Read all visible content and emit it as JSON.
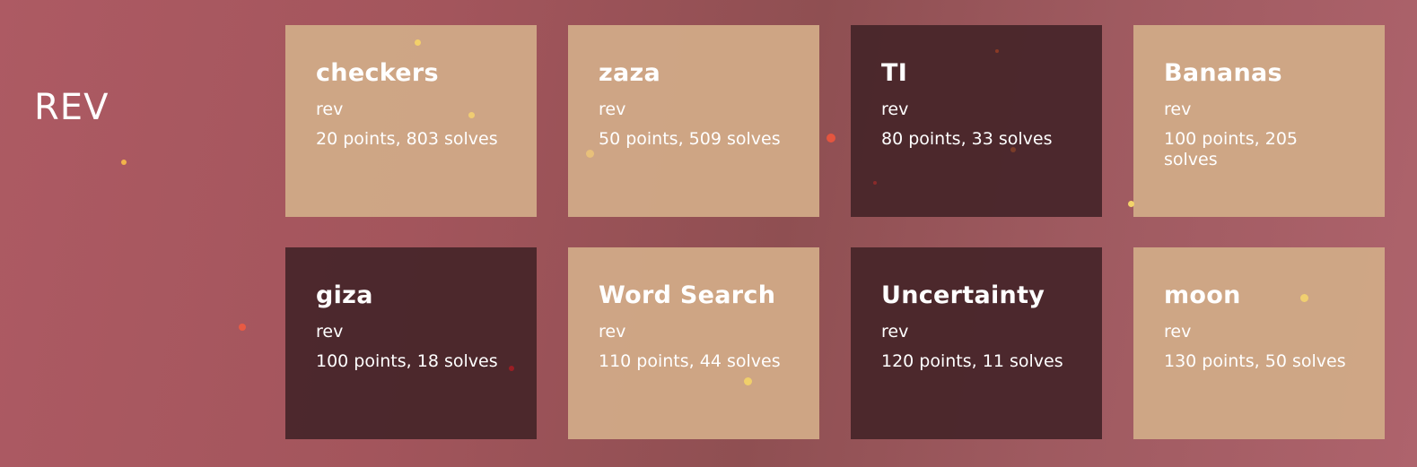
{
  "category": {
    "title": "REV"
  },
  "challenges": [
    {
      "name": "checkers",
      "category": "rev",
      "stats": "20 points, 803 solves",
      "solved": false
    },
    {
      "name": "zaza",
      "category": "rev",
      "stats": "50 points, 509 solves",
      "solved": false
    },
    {
      "name": "TI",
      "category": "rev",
      "stats": "80 points, 33 solves",
      "solved": true
    },
    {
      "name": "Bananas",
      "category": "rev",
      "stats": "100 points, 205 solves",
      "solved": false
    },
    {
      "name": "giza",
      "category": "rev",
      "stats": "100 points, 18 solves",
      "solved": true
    },
    {
      "name": "Word Search",
      "category": "rev",
      "stats": "110 points, 44 solves",
      "solved": false
    },
    {
      "name": "Uncertainty",
      "category": "rev",
      "stats": "120 points, 11 solves",
      "solved": true
    },
    {
      "name": "moon",
      "category": "rev",
      "stats": "130 points, 50 solves",
      "solved": false
    }
  ],
  "colors": {
    "unsolved_card": "#d0a886",
    "solved_card": "#48262a",
    "background": "#a3555c",
    "text": "#ffffff"
  }
}
